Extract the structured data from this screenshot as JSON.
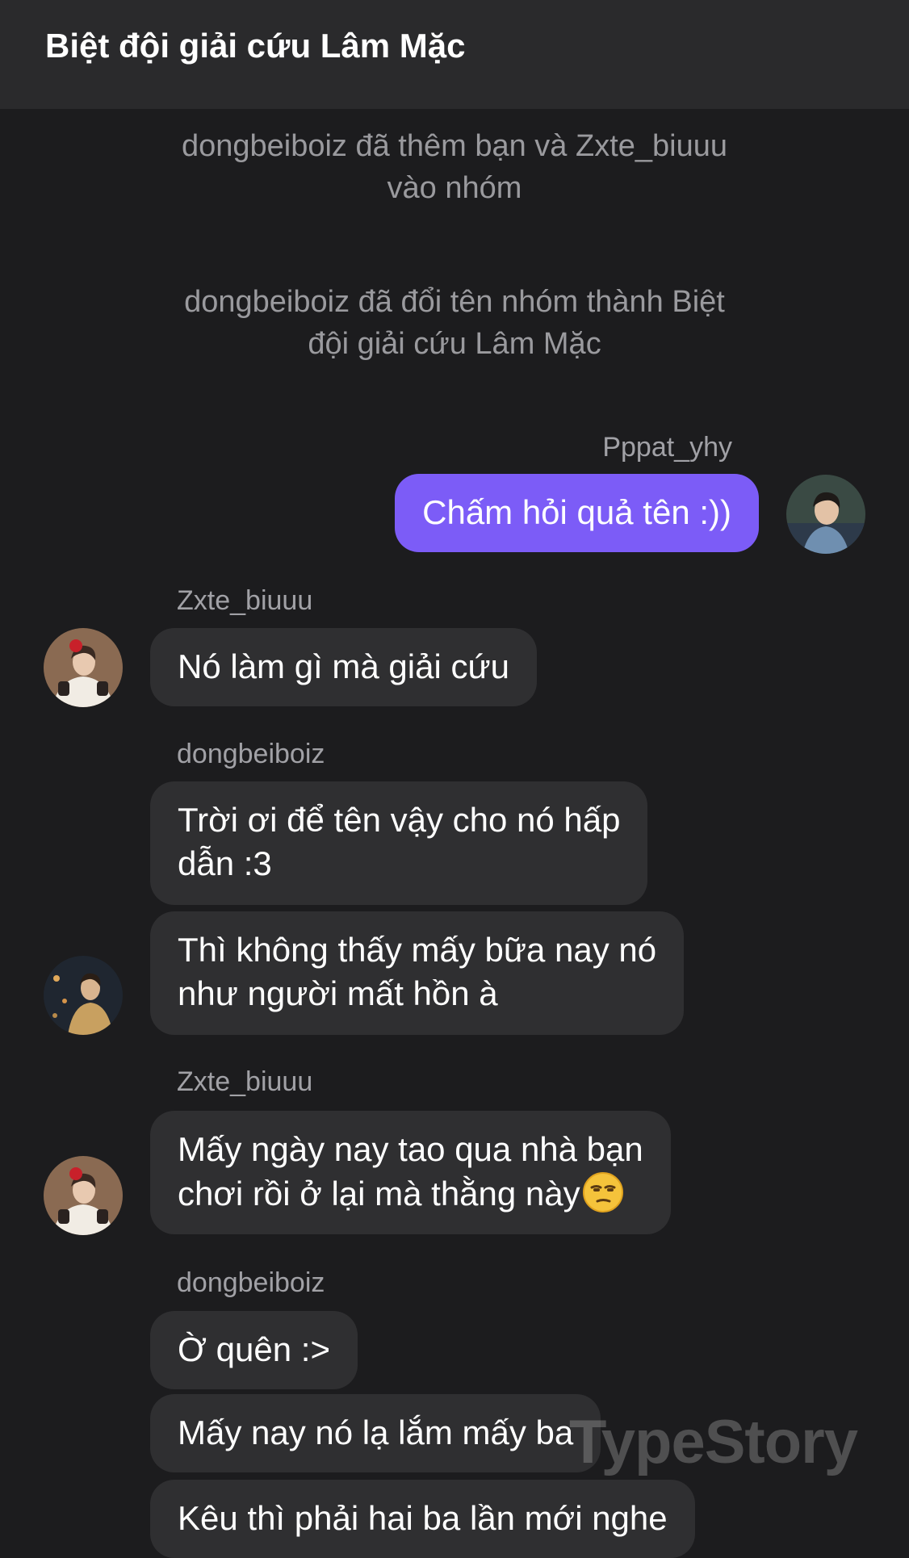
{
  "header": {
    "title": "Biệt đội giải cứu Lâm Mặc"
  },
  "system_messages": [
    {
      "lines": [
        "dongbeiboiz đã thêm bạn và Zxte_biuuu",
        "vào nhóm"
      ]
    },
    {
      "lines": [
        "dongbeiboiz đã đổi tên nhóm thành Biệt",
        "đội giải cứu Lâm Mặc"
      ]
    }
  ],
  "messages": [
    {
      "sender": "Pppat_yhy",
      "outgoing": true,
      "bubbles": [
        {
          "lines": [
            "Chấm hỏi quả tên :))"
          ]
        }
      ]
    },
    {
      "sender": "Zxte_biuuu",
      "outgoing": false,
      "bubbles": [
        {
          "lines": [
            "Nó làm gì mà giải cứu"
          ]
        }
      ]
    },
    {
      "sender": "dongbeiboiz",
      "outgoing": false,
      "bubbles": [
        {
          "lines": [
            "Trời ơi để tên vậy cho nó hấp",
            "dẫn :3"
          ]
        },
        {
          "lines": [
            "Thì không thấy mấy bữa nay nó",
            "như người mất hồn à"
          ]
        }
      ]
    },
    {
      "sender": "Zxte_biuuu",
      "outgoing": false,
      "bubbles": [
        {
          "lines": [
            "Mấy ngày nay tao qua nhà bạn",
            "chơi rồi ở lại mà thằng này"
          ],
          "emoji": "unamused-face-emoji"
        }
      ]
    },
    {
      "sender": "dongbeiboiz",
      "outgoing": false,
      "bubbles": [
        {
          "lines": [
            "Ờ quên :>"
          ]
        },
        {
          "lines": [
            "Mấy nay nó lạ lắm mấy ba"
          ]
        },
        {
          "lines": [
            "Kêu thì phải hai ba lần mới nghe"
          ]
        }
      ]
    }
  ],
  "watermark": "TypeStory",
  "colors": {
    "background": "#1c1c1e",
    "header": "#2a2a2c",
    "incoming_bubble": "#2f2f31",
    "outgoing_bubble": "#7c5cf7",
    "system_text": "#9a9a9e"
  }
}
